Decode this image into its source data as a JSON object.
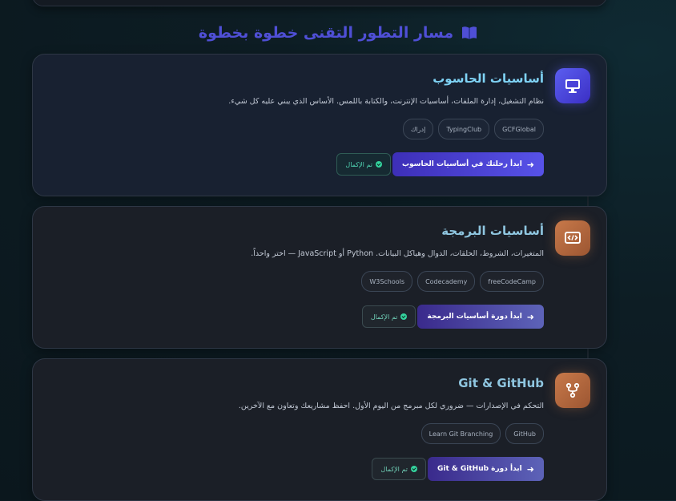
{
  "section": {
    "title": "مسار التطور التقنى خطوة بخطوة",
    "icon": "book-icon",
    "accent": "#4f4fd6"
  },
  "cards": [
    {
      "title": "أساسيات الحاسوب",
      "icon": "monitor-icon",
      "description": "نظام التشغيل، إدارة الملفات، أساسيات الإنترنت، والكتابة باللمس. الأساس الذي يبني عليه كل شيء.",
      "chips": [
        "GCFGlobal",
        "TypingClub",
        "إدراك"
      ],
      "primary_button": "ابدأ رحلتك في أساسيات الحاسوب",
      "done_button": "تم الإكمال"
    },
    {
      "title": "أساسيات البرمجة",
      "icon": "code-screen-icon",
      "description": "المتغيرات، الشروط، الحلقات، الدوال وهياكل البيانات. Python أو JavaScript — اختر واحداً.",
      "chips": [
        "freeCodeCamp",
        "Codecademy",
        "W3Schools"
      ],
      "primary_button": "ابدأ دورة أساسيات البرمجة",
      "done_button": "تم الإكمال"
    },
    {
      "title": "Git & GitHub",
      "icon": "git-branch-icon",
      "description": "التحكم في الإصدارات — ضروري لكل مبرمج من اليوم الأول. احفظ مشاريعك وتعاون مع الآخرين.",
      "chips": [
        "GitHub",
        "Learn Git Branching"
      ],
      "primary_button": "ابدأ دورة Git & GitHub",
      "done_button": "تم الإكمال"
    }
  ]
}
